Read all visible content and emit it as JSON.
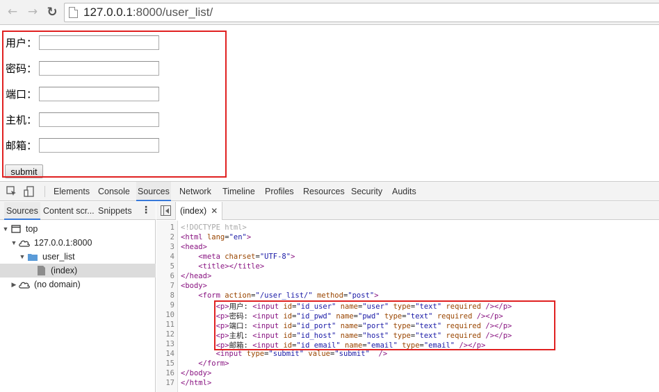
{
  "browser": {
    "url_host": "127.0.0.1",
    "url_rest": ":8000/user_list/"
  },
  "form": {
    "fields": [
      {
        "label": "用户："
      },
      {
        "label": "密码："
      },
      {
        "label": "端口："
      },
      {
        "label": "主机："
      },
      {
        "label": "邮箱："
      }
    ],
    "submit_label": "submit"
  },
  "devtools": {
    "tabs": [
      "Elements",
      "Console",
      "Sources",
      "Network",
      "Timeline",
      "Profiles",
      "Resources",
      "Security",
      "Audits"
    ],
    "active_tab": "Sources",
    "navigator_tabs": [
      "Sources",
      "Content scr...",
      "Snippets"
    ],
    "tree": {
      "top": "top",
      "origin": "127.0.0.1:8000",
      "folder": "user_list",
      "file": "(index)",
      "no_domain": "(no domain)"
    },
    "editor_tab": "(index)",
    "line_numbers": [
      "1",
      "2",
      "3",
      "4",
      "5",
      "6",
      "7",
      "8",
      "9",
      "10",
      "11",
      "12",
      "13",
      "14",
      "15",
      "16",
      "17"
    ],
    "code_lines": [
      "<!DOCTYPE html>",
      "<html lang=\"en\">",
      "<head>",
      "    <meta charset=\"UTF-8\">",
      "    <title></title>",
      "</head>",
      "<body>",
      "    <form action=\"/user_list/\" method=\"post\">",
      "        <p>用户: <input id=\"id_user\" name=\"user\" type=\"text\" required /></p>",
      "        <p>密码: <input id=\"id_pwd\" name=\"pwd\" type=\"text\" required /></p>",
      "        <p>端口: <input id=\"id_port\" name=\"port\" type=\"text\" required /></p>",
      "        <p>主机: <input id=\"id_host\" name=\"host\" type=\"text\" required /></p>",
      "        <p>邮箱: <input id=\"id_email\" name=\"email\" type=\"email\" /></p>",
      "        <input type=\"submit\" value=\"submit\"  />",
      "    </form>",
      "</body>",
      "</html>"
    ]
  },
  "colors": {
    "highlight_box": "#e02020",
    "active_tab_underline": "#3879d9",
    "tag": "#881280",
    "attribute": "#994500",
    "value": "#1a1aa6"
  },
  "icons": {
    "back": "back-arrow-icon",
    "forward": "forward-arrow-icon",
    "reload": "reload-icon",
    "page": "page-icon",
    "inspect": "inspect-element-icon",
    "device": "device-mode-icon",
    "more": "kebab-menu-icon",
    "toggle_navigator": "toggle-navigator-icon",
    "close": "close-icon",
    "frame": "frame-icon",
    "cloud": "cloud-icon",
    "folder": "folder-icon",
    "file": "file-icon"
  }
}
